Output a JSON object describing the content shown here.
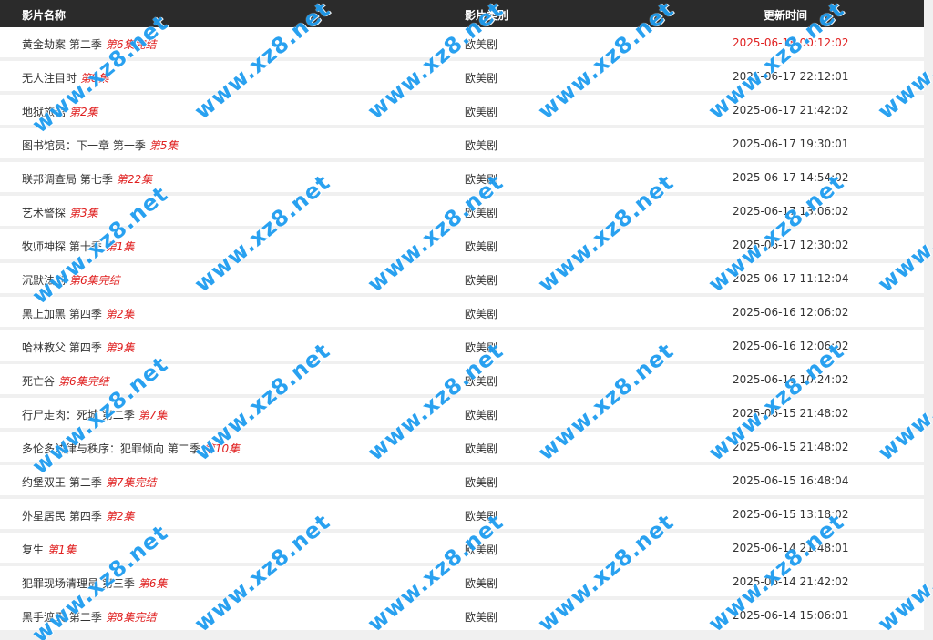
{
  "header": {
    "name": "影片名称",
    "type": "影片类别",
    "time": "更新时间"
  },
  "rows": [
    {
      "title": "黄金劫案 第二季",
      "episode": "第6集完结",
      "category": "欧美剧",
      "time": "2025-06-18 00:12:02"
    },
    {
      "title": "无人注目时",
      "episode": "第8集",
      "category": "欧美剧",
      "time": "2025-06-17 22:12:01"
    },
    {
      "title": "地狱旅馆",
      "episode": "第2集",
      "category": "欧美剧",
      "time": "2025-06-17 21:42:02"
    },
    {
      "title": "图书馆员：下一章 第一季",
      "episode": "第5集",
      "category": "欧美剧",
      "time": "2025-06-17 19:30:01"
    },
    {
      "title": "联邦调查局 第七季",
      "episode": "第22集",
      "category": "欧美剧",
      "time": "2025-06-17 14:54:02"
    },
    {
      "title": "艺术警探",
      "episode": "第3集",
      "category": "欧美剧",
      "time": "2025-06-17 13:06:02"
    },
    {
      "title": "牧师神探 第十季",
      "episode": "第1集",
      "category": "欧美剧",
      "time": "2025-06-17 12:30:02"
    },
    {
      "title": "沉默法则",
      "episode": "第6集完结",
      "category": "欧美剧",
      "time": "2025-06-17 11:12:04"
    },
    {
      "title": "黑上加黑 第四季",
      "episode": "第2集",
      "category": "欧美剧",
      "time": "2025-06-16 12:06:02"
    },
    {
      "title": "哈林教父 第四季",
      "episode": "第9集",
      "category": "欧美剧",
      "time": "2025-06-16 12:06:02"
    },
    {
      "title": "死亡谷",
      "episode": "第6集完结",
      "category": "欧美剧",
      "time": "2025-06-16 10:24:02"
    },
    {
      "title": "行尸走肉：死城 第二季",
      "episode": "第7集",
      "category": "欧美剧",
      "time": "2025-06-15 21:48:02"
    },
    {
      "title": "多伦多法律与秩序：犯罪倾向 第二季",
      "episode": "第10集",
      "category": "欧美剧",
      "time": "2025-06-15 21:48:02"
    },
    {
      "title": "约堡双王 第二季",
      "episode": "第7集完结",
      "category": "欧美剧",
      "time": "2025-06-15 16:48:04"
    },
    {
      "title": "外星居民 第四季",
      "episode": "第2集",
      "category": "欧美剧",
      "time": "2025-06-15 13:18:02"
    },
    {
      "title": "复生",
      "episode": "第1集",
      "category": "欧美剧",
      "time": "2025-06-14 21:48:01"
    },
    {
      "title": "犯罪现场清理员 第三季",
      "episode": "第6集",
      "category": "欧美剧",
      "time": "2025-06-14 21:42:02"
    },
    {
      "title": "黑手遮天 第二季",
      "episode": "第8集完结",
      "category": "欧美剧",
      "time": "2025-06-14 15:06:01"
    }
  ],
  "watermark": {
    "text": "www.xz8.net",
    "color": "#1e9cf0"
  },
  "colors": {
    "header_bg": "#2b2b2b",
    "episode": "#e02020",
    "latest_time": "#e02020"
  }
}
